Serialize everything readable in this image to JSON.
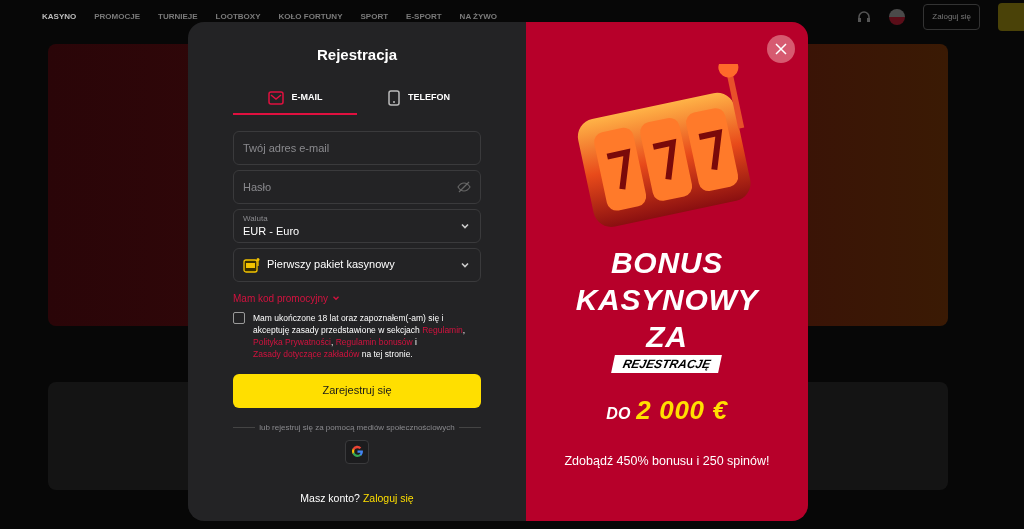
{
  "header": {
    "nav": [
      {
        "label": "KASYNO",
        "selected": true
      },
      {
        "label": "PROMOCJE",
        "selected": false
      },
      {
        "label": "TURNIEJE",
        "selected": false
      },
      {
        "label": "LOOTBOXY",
        "selected": false
      },
      {
        "label": "KOŁO FORTUNY",
        "selected": false
      },
      {
        "label": "SPORT",
        "selected": false
      },
      {
        "label": "E-SPORT",
        "selected": false
      },
      {
        "label": "NA ŻYWO",
        "selected": false
      }
    ],
    "login_button": "Zaloguj się"
  },
  "modal": {
    "title": "Rejestracja",
    "tabs": [
      {
        "label": "E-MAIL",
        "kind": "email",
        "selected": true
      },
      {
        "label": "TELEFON",
        "kind": "phone",
        "selected": false
      }
    ],
    "email_field": {
      "placeholder": "Twój adres e-mail"
    },
    "password_field": {
      "placeholder": "Hasło"
    },
    "currency_select": {
      "label": "Waluta",
      "value": "EUR - Euro"
    },
    "package_select": {
      "value": "Pierwszy pakiet kasynowy"
    },
    "promo_toggle": "Mam kod promocyjny",
    "consent": {
      "checked": false,
      "parts": [
        {
          "kind": "text",
          "text": "Mam ukończone 18 lat oraz zapoznałem(-am) się i akceptuję zasady przedstawione w sekcjach"
        },
        {
          "kind": "link",
          "text": "Regulamin"
        },
        {
          "kind": "text",
          "text": ","
        },
        {
          "kind": "link",
          "text": "Polityka Prywatności"
        },
        {
          "kind": "text",
          "text": ","
        },
        {
          "kind": "link",
          "text": "Regulamin bonusów"
        },
        {
          "kind": "text",
          "text": "i"
        },
        {
          "kind": "link",
          "text": "Zasady dotyczące zakładów"
        },
        {
          "kind": "text",
          "text": "na tej stronie."
        }
      ]
    },
    "submit": "Zarejestruj się",
    "social_label": "lub rejestruj się za pomocą mediów społecznościowych",
    "footer": {
      "text": "Masz konto?",
      "link": "Zaloguj się"
    },
    "promo": {
      "lines": [
        "BONUS",
        "KASYNOWY",
        "ZA"
      ],
      "tag": "REJESTRACJĘ",
      "prefix": "DO",
      "amount": "2 000 €",
      "subtitle": "Zdobądź 450% bonusu i 250 spinów!"
    }
  }
}
